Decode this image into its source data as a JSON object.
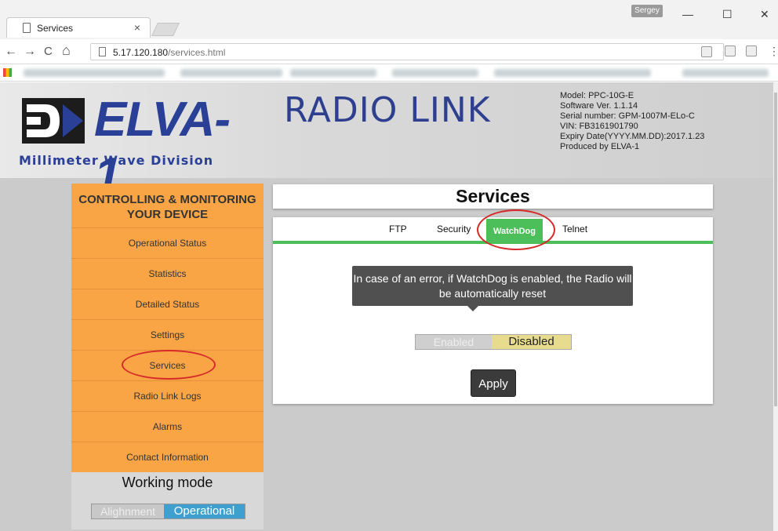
{
  "browser": {
    "tab_title": "Services",
    "tab_close": "×",
    "profile_name": "Sergey",
    "window_minimize": "—",
    "window_maximize": "☐",
    "window_close": "✕",
    "url_host": "5.17.120.180",
    "url_path": "/services.html",
    "nav_back": "←",
    "nav_forward": "→",
    "nav_reload": "C",
    "nav_home": "⌂",
    "menu": "⋮"
  },
  "header": {
    "logo_text": "ELVA-1",
    "logo_subtitle": "Millimeter Wave Division",
    "product_title": "RADIO LINK",
    "device_info": [
      "Model: PPC-10G-E",
      "Software Ver. 1.1.14",
      "Serial number: GPM-1007M-ELo-C",
      "VIN: FB3161901790",
      "Expiry Date(YYYY.MM.DD):2017.1.23",
      "Produced by ELVA-1"
    ]
  },
  "sidebar": {
    "heading": "CONTROLLING & MONITORING YOUR DEVICE",
    "items": [
      "Operational Status",
      "Statistics",
      "Detailed Status",
      "Settings",
      "Services",
      "Radio Link Logs",
      "Alarms",
      "Contact Information"
    ],
    "active_item": "Services",
    "working_mode": {
      "title": "Working mode",
      "option_off": "Alighnment",
      "option_on": "Operational",
      "selected": "Operational"
    }
  },
  "services": {
    "title": "Services",
    "tabs": [
      "FTP",
      "Security",
      "WatchDog",
      "Telnet"
    ],
    "active_tab": "WatchDog",
    "tooltip": "In case of an error, if WatchDog is enabled, the Radio will be automatically reset",
    "toggle_off": "Enabled",
    "toggle_on": "Disabled",
    "selected": "Disabled",
    "apply_label": "Apply"
  },
  "colors": {
    "sidebar_bg": "#f9a545",
    "active_tab": "#4cbf5a",
    "brand_blue": "#2a3f96",
    "annotation_red": "#d62a2a"
  }
}
